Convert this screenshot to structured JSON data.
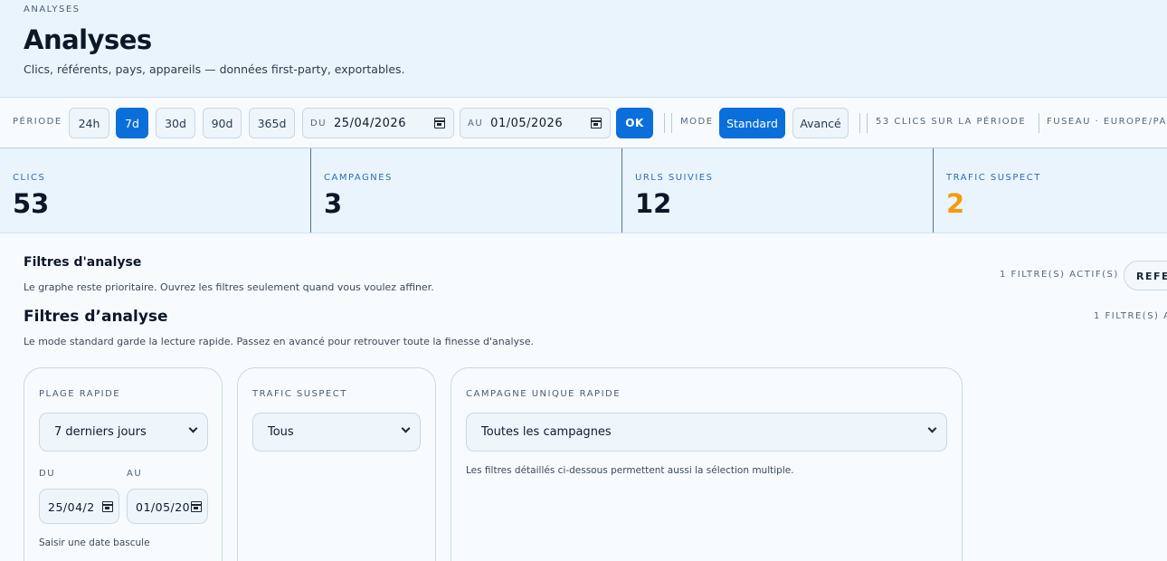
{
  "header": {
    "eyebrow": "ANALYSES",
    "title": "Analyses",
    "subtitle": "Clics, référents, pays, appareils — données first-party, exportables."
  },
  "toolbar": {
    "period_label": "PÉRIODE",
    "periods": [
      "24h",
      "7d",
      "30d",
      "90d",
      "365d"
    ],
    "active_period": "7d",
    "from_prefix": "DU",
    "from_value": "25/04/2026",
    "to_prefix": "AU",
    "to_value": "01/05/2026",
    "ok_label": "OK",
    "mode_label": "MODE",
    "modes": [
      "Standard",
      "Avancé"
    ],
    "active_mode": "Standard",
    "clicks_summary": "53 CLICS SUR LA PÉRIODE",
    "timezone": "FUSEAU · EUROPE/PA"
  },
  "stats": [
    {
      "label": "CLICS",
      "value": "53"
    },
    {
      "label": "CAMPAGNES",
      "value": "3"
    },
    {
      "label": "URLS SUIVIES",
      "value": "12"
    },
    {
      "label": "TRAFIC SUSPECT",
      "value": "2"
    }
  ],
  "filters_section_1": {
    "title": "Filtres d'analyse",
    "description": "Le graphe reste prioritaire. Ouvrez les filtres seulement quand vous voulez affiner.",
    "active_count": "1 FILTRE(S) ACTIF(S)",
    "refresh_label": "REFEI"
  },
  "filters_section_2": {
    "title": "Filtres d’analyse",
    "description": "Le mode standard garde la lecture rapide. Passez en avancé pour retrouver toute la finesse d'analyse.",
    "active_count": "1 FILTRE(S) A"
  },
  "cards": {
    "quick_range": {
      "label": "PLAGE RAPIDE",
      "selected": "7 derniers jours",
      "from_label": "DU",
      "to_label": "AU",
      "from_value": "25/04/2",
      "to_value": "01/05/20",
      "hint": "Saisir une date bascule"
    },
    "suspect_traffic": {
      "label": "TRAFIC SUSPECT",
      "selected": "Tous"
    },
    "campaign": {
      "label": "CAMPAGNE UNIQUE RAPIDE",
      "selected": "Toutes les campagnes",
      "note": "Les filtres détaillés ci-dessous permettent aussi la sélection multiple."
    }
  },
  "colors": {
    "accent": "#0a6fdb",
    "warning": "#f39a12",
    "stat_label": "#2a6fb3"
  }
}
